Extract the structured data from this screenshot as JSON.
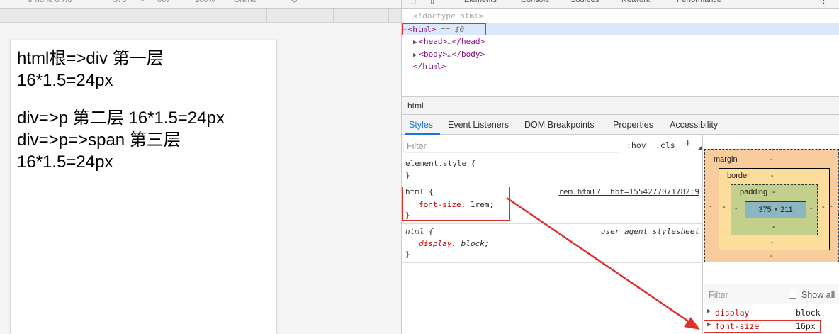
{
  "page": {
    "lines": [
      "html根=>div 第一层",
      "16*1.5=24px",
      "div=>p 第二层 16*1.5=24px",
      "div=>p=>span 第三层",
      "16*1.5=24px"
    ]
  },
  "dom": {
    "doctype": "<!doctype html>",
    "html_open": "html",
    "dollar": "== $0",
    "head_tag": "head",
    "body_tag": "body",
    "html_close": "html"
  },
  "crumb": "html",
  "tabs": [
    "Styles",
    "Event Listeners",
    "DOM Breakpoints",
    "Properties",
    "Accessibility"
  ],
  "styles": {
    "filter_placeholder": "Filter",
    "hov": ":hov",
    "cls": ".cls",
    "add": "+",
    "element_style": "element.style {",
    "close_brace": "}",
    "rule1": {
      "selector": "html {",
      "prop": "font-size",
      "value": "1rem;",
      "source": "rem.html?__hbt=1554277071782:9"
    },
    "rule2": {
      "selector": "html {",
      "prop": "display",
      "value": "block;",
      "source": "user agent stylesheet"
    }
  },
  "box_model": {
    "margin_label": "margin",
    "border_label": "border",
    "padding_label": "padding",
    "dash": "-",
    "content": "375 × 211"
  },
  "computed": {
    "filter_placeholder": "Filter",
    "show_all": "Show all",
    "rows": [
      {
        "name": "display",
        "value": "block"
      },
      {
        "name": "font-size",
        "value": "16px"
      }
    ]
  },
  "colors": {
    "highlight": "#e0302a",
    "tab_active": "#1a73e8"
  }
}
